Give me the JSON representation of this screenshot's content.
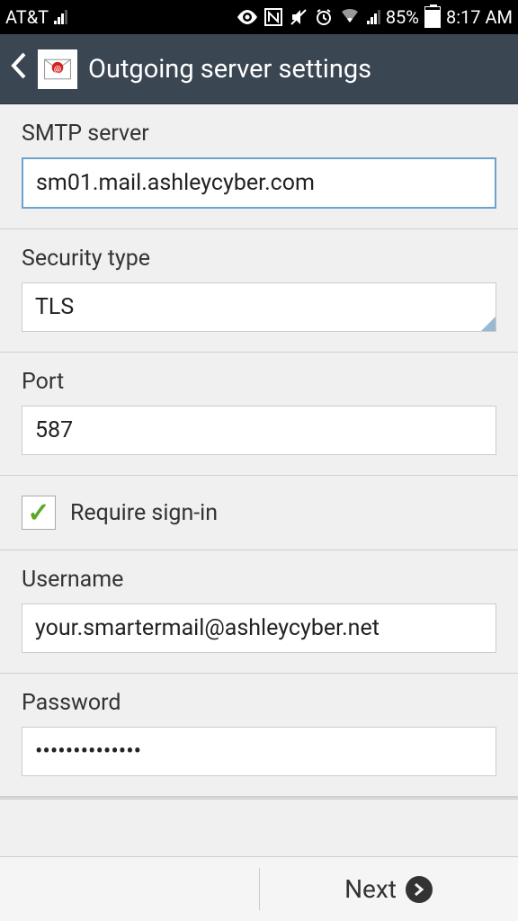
{
  "status": {
    "carrier": "AT&T",
    "battery_pct": "85%",
    "time": "8:17 AM"
  },
  "header": {
    "title": "Outgoing server settings"
  },
  "fields": {
    "smtp_label": "SMTP server",
    "smtp_value": "sm01.mail.ashleycyber.com",
    "security_label": "Security type",
    "security_value": "TLS",
    "port_label": "Port",
    "port_value": "587",
    "signin_label": "Require sign-in",
    "signin_checked": true,
    "username_label": "Username",
    "username_value": "your.smartermail@ashleycyber.net",
    "password_label": "Password",
    "password_value": "••••••••••••••"
  },
  "footer": {
    "next_label": "Next"
  }
}
